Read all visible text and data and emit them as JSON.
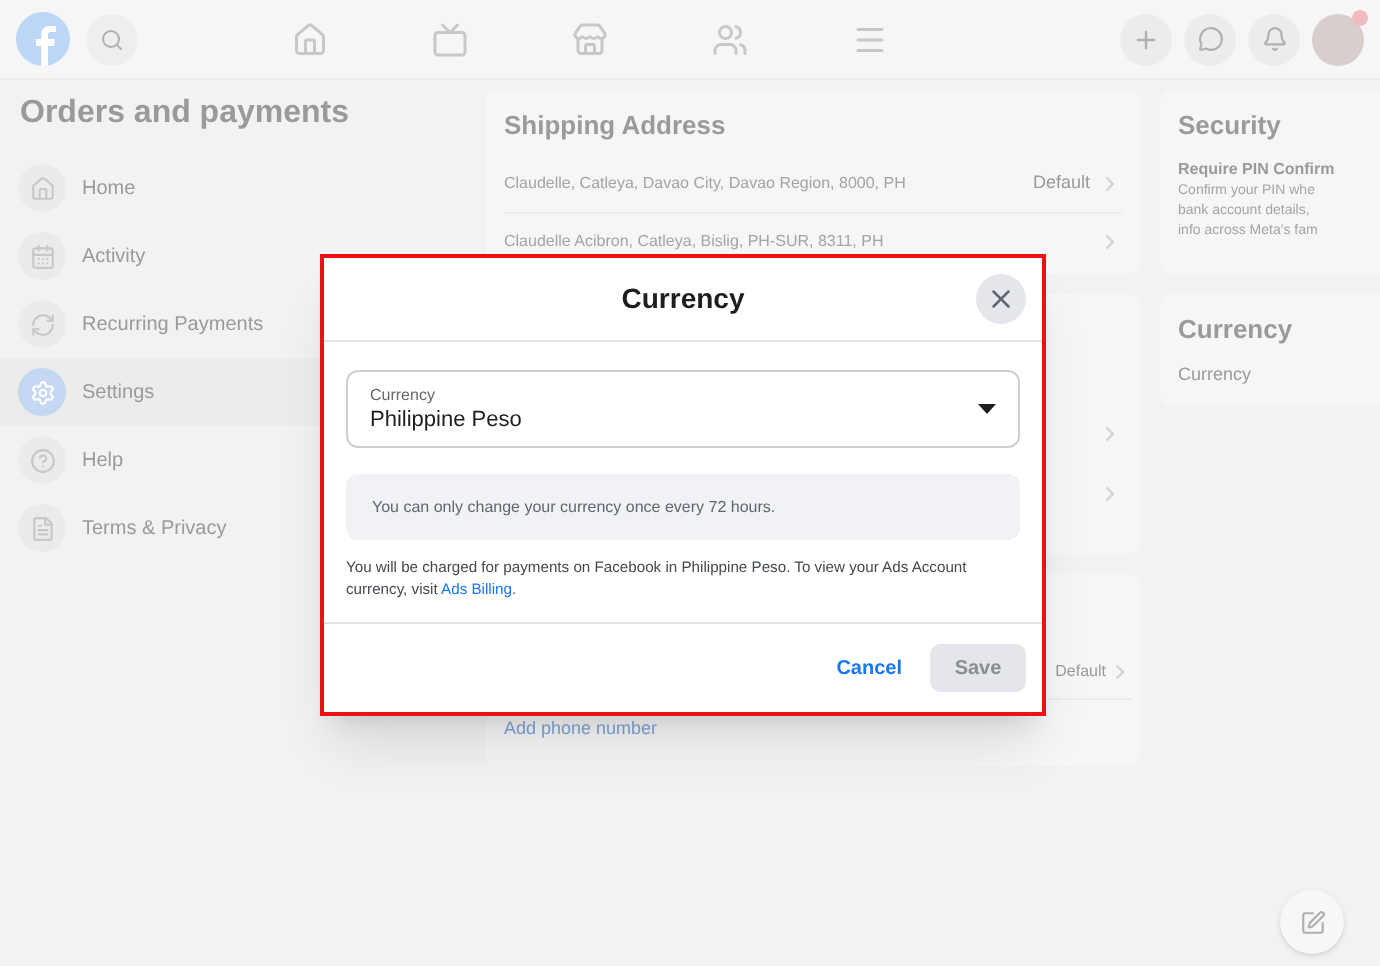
{
  "sidebar": {
    "title": "Orders and payments",
    "items": [
      {
        "label": "Home",
        "selected": false
      },
      {
        "label": "Activity",
        "selected": false
      },
      {
        "label": "Recurring Payments",
        "selected": false
      },
      {
        "label": "Settings",
        "selected": true
      },
      {
        "label": "Help",
        "selected": false
      },
      {
        "label": "Terms & Privacy",
        "selected": false
      }
    ]
  },
  "shipping_address": {
    "title": "Shipping Address",
    "addresses": [
      {
        "text": "Claudelle, Catleya, Davao City, Davao Region, 8000, PH",
        "default": "Default"
      },
      {
        "text": "Claudelle Acibron, Catleya, Bislig, PH-SUR, 8311, PH"
      }
    ]
  },
  "phone": {
    "default": "Default",
    "add_link": "Add phone number"
  },
  "security": {
    "title": "Security",
    "setting": "Require PIN Confirm",
    "description": [
      "Confirm your PIN whe",
      "bank account details,",
      "info across Meta's fam"
    ]
  },
  "currency_card": {
    "title": "Currency",
    "value": "Currency"
  },
  "dialog": {
    "title": "Currency",
    "field": {
      "label": "Currency",
      "value": "Philippine Peso"
    },
    "notice": "You can only change your currency once every 72 hours.",
    "description": "You will be charged for payments on Facebook in Philippine Peso. To view your Ads Account currency, visit ",
    "link": "Ads Billing",
    "description_end": ".",
    "buttons": [
      {
        "label": "Cancel",
        "kind": "link",
        "disabled": false
      },
      {
        "label": "Save",
        "kind": "primary",
        "disabled": true
      }
    ]
  }
}
